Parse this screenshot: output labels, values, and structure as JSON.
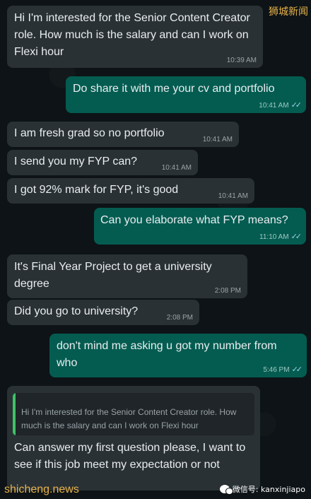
{
  "messages": [
    {
      "direction": "incoming",
      "text": "Hi I'm interested for the Senior Content Creator role. How much is the salary and can I work on Flexi hour",
      "time": "10:39 AM"
    },
    {
      "direction": "outgoing",
      "text": "Do share it with me your cv and portfolio",
      "time": "10:41 AM",
      "ticks": "✓✓"
    },
    {
      "direction": "incoming",
      "text": "I am fresh grad so no portfolio",
      "time": "10:41 AM"
    },
    {
      "direction": "incoming",
      "text": "I send you my FYP can?",
      "time": "10:41 AM"
    },
    {
      "direction": "incoming",
      "text": "I got 92% mark for FYP, it's good",
      "time": "10:41 AM"
    },
    {
      "direction": "outgoing",
      "text": "Can you elaborate what FYP means?",
      "time": "11:10 AM",
      "ticks": "✓✓"
    },
    {
      "direction": "incoming",
      "text": "It's Final Year Project to get a university degree",
      "time": "2:08 PM"
    },
    {
      "direction": "incoming",
      "text": "Did you go to university?",
      "time": "2:08 PM"
    },
    {
      "direction": "outgoing",
      "text": "don't mind me asking u got my number from who",
      "time": "5:46 PM",
      "ticks": "✓✓"
    },
    {
      "direction": "incoming",
      "quote": "Hi I'm interested for the Senior Content Creator role. How much is the salary and can I work on Flexi hour",
      "text": "Can answer my first question please, I want to see if this job meet my expectation or not"
    }
  ],
  "watermarks": {
    "top_right": "狮城新闻",
    "bottom_left": "shicheng.news",
    "bottom_right": "微信号: kanxinjiapo"
  },
  "colors": {
    "background": "#0d1316",
    "incoming_bubble": "#2a3135",
    "outgoing_bubble": "#045c51",
    "read_ticks": "#9fd0e6",
    "quote_bar": "#3ec267",
    "watermark": "#e8b34b"
  },
  "icons": {
    "read_receipt": "double-check-icon",
    "wechat": "wechat-icon"
  }
}
